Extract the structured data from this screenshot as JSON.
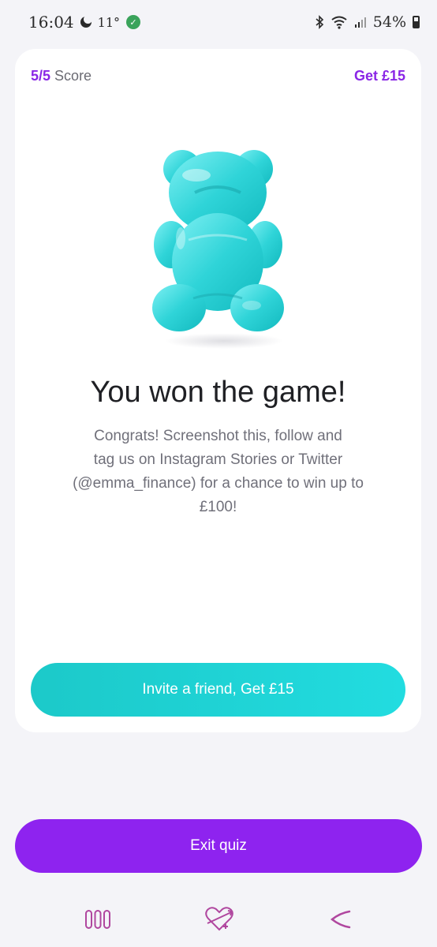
{
  "status_bar": {
    "time": "16:04",
    "temperature": "11°",
    "battery": "54%",
    "icons": [
      "moon-icon",
      "leaf-icon",
      "bluetooth-icon",
      "wifi-icon",
      "signal-icon",
      "battery-icon"
    ]
  },
  "card": {
    "score_value": "5/5",
    "score_label": "Score",
    "get_link": "Get £15",
    "illustration": "gummy-bear-illustration",
    "headline": "You won the game!",
    "body_line1": "Congrats! Screenshot this, follow and",
    "body_line2": "tag us on Instagram Stories or Twitter",
    "body_line3": "(@emma_finance) for a chance to win up to",
    "body_line4": "£100!",
    "invite_button": "Invite a friend, Get £15"
  },
  "exit_button": "Exit quiz",
  "colors": {
    "accent_purple": "#8e23ef",
    "accent_teal": "#1fd3d6",
    "background": "#f4f4f8",
    "card": "#ffffff"
  },
  "nav_bar": {
    "items": [
      "recent-apps-icon",
      "home-icon",
      "back-icon"
    ]
  }
}
